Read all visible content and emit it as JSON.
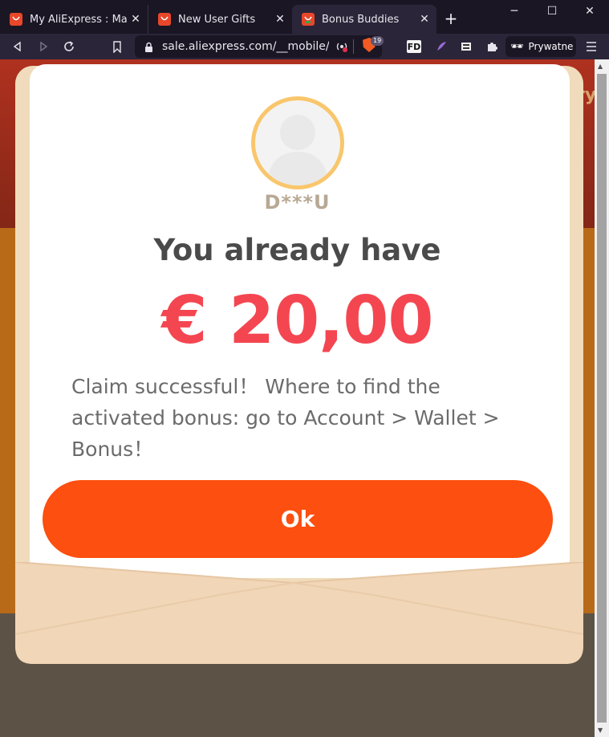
{
  "browser": {
    "tabs": [
      {
        "title": "My AliExpress : Manage"
      },
      {
        "title": "New User Gifts"
      },
      {
        "title": "Bonus Buddies"
      }
    ],
    "url": "sale.aliexpress.com/__mobile/d...",
    "shield_count": "19",
    "profile_label": "Prywatne",
    "extension_fd": "FD"
  },
  "page": {
    "background_hint": "ry"
  },
  "modal": {
    "username": "D***U",
    "headline": "You already have",
    "amount": "€ 20,00",
    "message": "Claim successful！ Where to find the activated bonus: go to Account > Wallet > Bonus！",
    "ok_label": "Ok"
  },
  "colors": {
    "accent": "#fd4f0f",
    "amount": "#f44651",
    "avatar_ring": "#f9c66c"
  }
}
